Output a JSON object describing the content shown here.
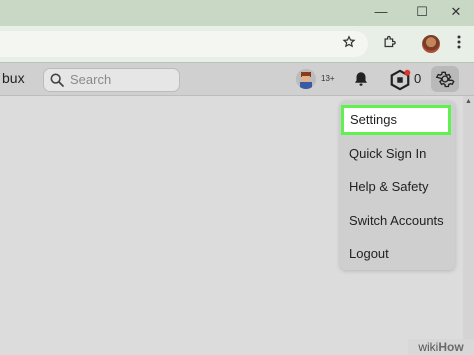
{
  "window": {
    "minimize_glyph": "—",
    "maximize_glyph": "☐",
    "close_glyph": "✕"
  },
  "chrome": {
    "icons": [
      "star-icon",
      "extensions-icon",
      "profile-avatar",
      "kebab-menu-icon"
    ]
  },
  "header": {
    "brand_partial": "bux",
    "search_placeholder": "Search",
    "age_badge": "13+",
    "robux_count": "0"
  },
  "settings_menu": {
    "items": [
      {
        "label": "Settings",
        "highlighted": true
      },
      {
        "label": "Quick Sign In"
      },
      {
        "label": "Help & Safety"
      },
      {
        "label": "Switch Accounts"
      },
      {
        "label": "Logout"
      }
    ]
  },
  "watermark": {
    "prefix": "wiki",
    "suffix": "How"
  },
  "colors": {
    "highlight_border": "#5ef14f",
    "chrome_green": "#c9d8c5",
    "header_bg": "#d0d0d0"
  }
}
